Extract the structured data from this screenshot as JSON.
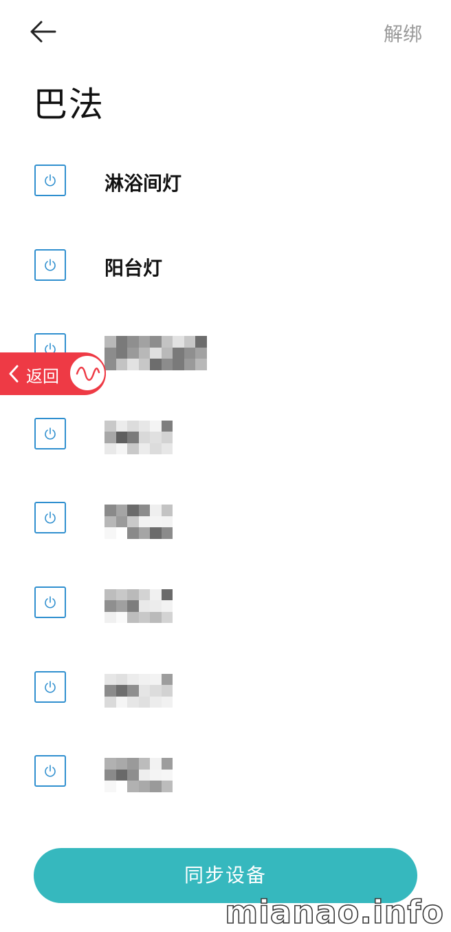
{
  "header": {
    "back_icon": "arrow-left-icon",
    "unbind_label": "解绑"
  },
  "page_title": "巴法",
  "devices": [
    {
      "name": "淋浴间灯",
      "icon": "power-icon",
      "masked": false
    },
    {
      "name": "阳台灯",
      "icon": "power-icon",
      "masked": false
    },
    {
      "name": "",
      "icon": "power-icon",
      "masked": true
    },
    {
      "name": "",
      "icon": "power-icon",
      "masked": true
    },
    {
      "name": "",
      "icon": "power-icon",
      "masked": true
    },
    {
      "name": "",
      "icon": "power-icon",
      "masked": true
    },
    {
      "name": "",
      "icon": "power-icon",
      "masked": true
    },
    {
      "name": "",
      "icon": "power-icon",
      "masked": true
    }
  ],
  "overlay": {
    "back_label": "返回",
    "icon": "wave-icon",
    "color": "#ee3a45"
  },
  "sync_button": {
    "label": "同步设备",
    "color": "#36b8be"
  },
  "watermark": "mianao.info",
  "colors": {
    "icon_border": "#2f8fcf",
    "unbind_text": "#9a9a9a"
  }
}
